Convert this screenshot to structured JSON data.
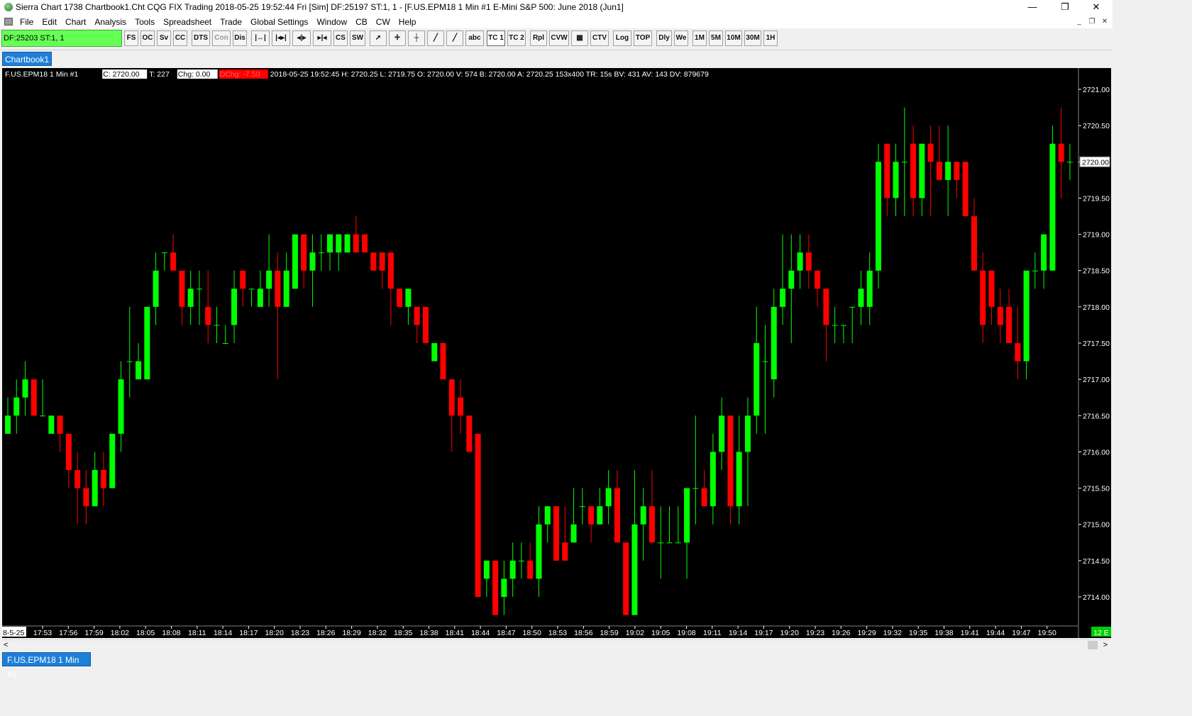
{
  "window": {
    "title": "Sierra Chart 1738 Chartbook1.Cht  CQG FIX Trading 2018-05-25  19:52:44 Fri [Sim]  DF:25197  ST:1, 1 - [F.US.EPM18  1 Min   #1  E-Mini S&P 500: June 2018 (Jun1]",
    "controls": {
      "minimize": "—",
      "restore": "❐",
      "close": "✕"
    }
  },
  "menu": {
    "items": [
      "File",
      "Edit",
      "Chart",
      "Analysis",
      "Tools",
      "Spreadsheet",
      "Trade",
      "Global Settings",
      "Window",
      "CB",
      "CW",
      "Help"
    ],
    "mdi_controls": {
      "minimize": "_",
      "restore": "❐",
      "close": "✕"
    }
  },
  "toolbar": {
    "df_label": "DF:25203  ST:1, 1",
    "buttons": [
      "FS",
      "OC",
      "Sv",
      "CC",
      "DTS",
      "Con",
      "Dis",
      "|↔|",
      "|◂▸|",
      "◂|▸",
      "▸|◂",
      "CS",
      "SW",
      "➚",
      "✛",
      "┼",
      "╱",
      "╱",
      "abc",
      "TC 1",
      "TC 2",
      "Rpl",
      "CVW",
      "▦",
      "CTV",
      "Log",
      "TOP",
      "Dly",
      "We",
      "1M",
      "5M",
      "10M",
      "30M",
      "1H"
    ]
  },
  "tabs": {
    "chartbook": "Chartbook1",
    "sheet": "F.US.EPM18  1 Min   #1"
  },
  "scrollbar": {
    "left_arrow": "<",
    "right_arrow": ">"
  },
  "chart_data": {
    "type": "candlestick",
    "symbol": "F.US.EPM18",
    "interval": "1 Min",
    "chart_number": "#1",
    "info_line": {
      "symbol_text": "F.US.EPM18  1 Min   #1",
      "close": "C: 2720.00",
      "trades": "T: 227",
      "chg": "Chg: 0.00",
      "dchg": "DChg: -7.50",
      "rest": "2018-05-25 19:52:45 H: 2720.25 L: 2719.75 O: 2720.00 V: 574 B: 2720.00 A: 2720.25 153x400 TR: 15s BV: 431 AV: 143 DV: 879679"
    },
    "colors": {
      "up": "#00ff00",
      "down": "#ff0000",
      "background": "#000000",
      "text": "#ffffff",
      "dchg_bg": "#ff0000",
      "last_price_bg": "#ffffff",
      "indicator_bg": "#00cc00"
    },
    "y_axis": {
      "min": 2713.5,
      "max": 2721.3,
      "ticks": [
        "2721.00",
        "2720.50",
        "2720.00",
        "2719.50",
        "2719.00",
        "2718.50",
        "2718.00",
        "2717.50",
        "2717.00",
        "2716.50",
        "2716.00",
        "2715.50",
        "2715.00",
        "2714.50",
        "2714.00"
      ],
      "last_price_label": "2720.00"
    },
    "x_axis": {
      "start_label": "8-5-25",
      "labels": [
        "17:53",
        "17:56",
        "17:59",
        "18:02",
        "18:05",
        "18:08",
        "18:11",
        "18:14",
        "18:17",
        "18:20",
        "18:23",
        "18:26",
        "18:29",
        "18:32",
        "18:35",
        "18:38",
        "18:41",
        "18:44",
        "18:47",
        "18:50",
        "18:53",
        "18:56",
        "18:59",
        "19:02",
        "19:05",
        "19:08",
        "19:11",
        "19:14",
        "19:17",
        "19:20",
        "19:23",
        "19:26",
        "19:29",
        "19:32",
        "19:35",
        "19:38",
        "19:41",
        "19:44",
        "19:47",
        "19:50"
      ],
      "indicator": "12 E"
    },
    "candles": [
      [
        2716.25,
        2716.75,
        2716.25,
        2716.5
      ],
      [
        2716.5,
        2717.0,
        2716.25,
        2716.75
      ],
      [
        2716.75,
        2717.25,
        2716.5,
        2717.0
      ],
      [
        2717.0,
        2717.0,
        2716.5,
        2716.5
      ],
      [
        2716.5,
        2717.0,
        2716.5,
        2716.5
      ],
      [
        2716.25,
        2716.5,
        2716.25,
        2716.5
      ],
      [
        2716.5,
        2716.5,
        2716.0,
        2716.25
      ],
      [
        2716.25,
        2716.25,
        2715.5,
        2715.75
      ],
      [
        2715.75,
        2716.0,
        2715.0,
        2715.5
      ],
      [
        2715.5,
        2715.75,
        2715.0,
        2715.25
      ],
      [
        2715.25,
        2716.0,
        2715.25,
        2715.75
      ],
      [
        2715.75,
        2716.0,
        2715.25,
        2715.5
      ],
      [
        2715.5,
        2716.25,
        2715.5,
        2716.25
      ],
      [
        2716.25,
        2717.25,
        2716.0,
        2717.0
      ],
      [
        2717.25,
        2718.0,
        2716.75,
        2717.25
      ],
      [
        2717.0,
        2717.5,
        2717.0,
        2717.25
      ],
      [
        2717.0,
        2718.0,
        2717.0,
        2718.0
      ],
      [
        2718.0,
        2718.75,
        2717.75,
        2718.5
      ],
      [
        2718.75,
        2718.75,
        2718.5,
        2718.75
      ],
      [
        2718.75,
        2719.0,
        2718.5,
        2718.5
      ],
      [
        2718.5,
        2718.5,
        2717.75,
        2718.0
      ],
      [
        2718.0,
        2718.5,
        2717.75,
        2718.25
      ],
      [
        2718.25,
        2718.5,
        2717.75,
        2718.25
      ],
      [
        2718.0,
        2718.5,
        2717.5,
        2717.75
      ],
      [
        2717.75,
        2718.0,
        2717.5,
        2717.75
      ],
      [
        2717.5,
        2717.75,
        2717.5,
        2717.5
      ],
      [
        2717.75,
        2718.5,
        2717.5,
        2718.25
      ],
      [
        2718.5,
        2718.5,
        2718.0,
        2718.25
      ],
      [
        2718.25,
        2718.25,
        2718.0,
        2718.25
      ],
      [
        2718.0,
        2718.5,
        2718.0,
        2718.25
      ],
      [
        2718.25,
        2719.0,
        2718.0,
        2718.5
      ],
      [
        2718.5,
        2718.75,
        2717.0,
        2718.0
      ],
      [
        2718.0,
        2718.75,
        2718.0,
        2718.5
      ],
      [
        2718.25,
        2719.0,
        2718.25,
        2719.0
      ],
      [
        2719.0,
        2719.0,
        2718.25,
        2718.5
      ],
      [
        2718.5,
        2719.0,
        2718.0,
        2718.75
      ],
      [
        2718.75,
        2719.0,
        2718.5,
        2718.75
      ],
      [
        2718.75,
        2719.0,
        2718.5,
        2719.0
      ],
      [
        2718.75,
        2719.0,
        2718.5,
        2719.0
      ],
      [
        2718.75,
        2719.0,
        2718.75,
        2719.0
      ],
      [
        2719.0,
        2719.25,
        2718.75,
        2718.75
      ],
      [
        2719.0,
        2719.0,
        2718.75,
        2718.75
      ],
      [
        2718.75,
        2718.75,
        2718.5,
        2718.5
      ],
      [
        2718.75,
        2718.75,
        2718.25,
        2718.5
      ],
      [
        2718.75,
        2718.75,
        2717.75,
        2718.25
      ],
      [
        2718.25,
        2718.25,
        2718.0,
        2718.0
      ],
      [
        2718.0,
        2718.25,
        2717.75,
        2718.25
      ],
      [
        2718.0,
        2718.0,
        2717.5,
        2717.75
      ],
      [
        2718.0,
        2718.0,
        2717.5,
        2717.5
      ],
      [
        2717.25,
        2717.5,
        2717.25,
        2717.5
      ],
      [
        2717.5,
        2717.5,
        2717.0,
        2717.0
      ],
      [
        2717.0,
        2717.0,
        2716.0,
        2716.5
      ],
      [
        2716.75,
        2717.0,
        2716.25,
        2716.5
      ],
      [
        2716.5,
        2716.5,
        2716.0,
        2716.0
      ],
      [
        2716.25,
        2716.25,
        2714.0,
        2714.0
      ],
      [
        2714.25,
        2714.5,
        2714.0,
        2714.5
      ],
      [
        2714.5,
        2714.5,
        2713.75,
        2713.75
      ],
      [
        2714.0,
        2714.5,
        2713.75,
        2714.25
      ],
      [
        2714.25,
        2714.75,
        2714.0,
        2714.5
      ],
      [
        2714.5,
        2714.75,
        2714.25,
        2714.5
      ],
      [
        2714.5,
        2714.75,
        2714.25,
        2714.25
      ],
      [
        2714.25,
        2715.25,
        2714.0,
        2715.0
      ],
      [
        2715.0,
        2715.25,
        2714.75,
        2715.25
      ],
      [
        2715.25,
        2715.25,
        2714.5,
        2714.5
      ],
      [
        2714.75,
        2715.25,
        2714.5,
        2714.5
      ],
      [
        2714.75,
        2715.5,
        2714.75,
        2715.0
      ],
      [
        2715.25,
        2715.5,
        2715.0,
        2715.25
      ],
      [
        2715.25,
        2715.25,
        2714.75,
        2715.0
      ],
      [
        2715.0,
        2715.5,
        2715.0,
        2715.25
      ],
      [
        2715.25,
        2715.75,
        2715.0,
        2715.5
      ],
      [
        2715.5,
        2715.75,
        2714.75,
        2714.75
      ],
      [
        2714.75,
        2714.75,
        2713.75,
        2713.75
      ],
      [
        2713.75,
        2715.75,
        2713.75,
        2715.0
      ],
      [
        2715.0,
        2715.5,
        2714.5,
        2715.25
      ],
      [
        2715.25,
        2715.75,
        2714.75,
        2714.75
      ],
      [
        2714.75,
        2715.25,
        2714.25,
        2714.75
      ],
      [
        2714.75,
        2715.25,
        2714.75,
        2714.75
      ],
      [
        2714.75,
        2715.25,
        2714.75,
        2714.75
      ],
      [
        2714.75,
        2715.5,
        2714.25,
        2715.5
      ],
      [
        2715.5,
        2716.5,
        2715.0,
        2715.5
      ],
      [
        2715.5,
        2715.75,
        2715.25,
        2715.25
      ],
      [
        2715.25,
        2716.25,
        2715.0,
        2716.0
      ],
      [
        2716.0,
        2716.75,
        2715.75,
        2716.5
      ],
      [
        2716.5,
        2716.5,
        2715.0,
        2715.25
      ],
      [
        2715.25,
        2716.5,
        2715.0,
        2716.0
      ],
      [
        2716.0,
        2716.75,
        2715.25,
        2716.5
      ],
      [
        2716.5,
        2718.0,
        2716.25,
        2717.5
      ],
      [
        2717.25,
        2717.75,
        2716.25,
        2717.25
      ],
      [
        2717.0,
        2718.25,
        2716.75,
        2718.0
      ],
      [
        2718.0,
        2719.0,
        2717.75,
        2718.25
      ],
      [
        2718.25,
        2719.0,
        2717.5,
        2718.5
      ],
      [
        2718.5,
        2719.0,
        2718.25,
        2718.75
      ],
      [
        2718.75,
        2719.0,
        2718.25,
        2718.5
      ],
      [
        2718.5,
        2718.5,
        2718.0,
        2718.25
      ],
      [
        2718.25,
        2718.25,
        2717.25,
        2717.75
      ],
      [
        2717.75,
        2718.0,
        2717.5,
        2717.75
      ],
      [
        2717.75,
        2717.75,
        2717.5,
        2717.75
      ],
      [
        2718.0,
        2718.0,
        2717.5,
        2718.0
      ],
      [
        2718.0,
        2718.5,
        2717.75,
        2718.25
      ],
      [
        2718.0,
        2718.75,
        2717.75,
        2718.5
      ],
      [
        2718.5,
        2720.25,
        2718.25,
        2720.0
      ],
      [
        2720.25,
        2720.25,
        2719.25,
        2719.5
      ],
      [
        2719.5,
        2720.25,
        2719.25,
        2720.0
      ],
      [
        2720.0,
        2720.75,
        2719.25,
        2720.0
      ],
      [
        2720.25,
        2720.5,
        2719.25,
        2719.5
      ],
      [
        2719.5,
        2720.25,
        2719.25,
        2720.25
      ],
      [
        2720.25,
        2720.5,
        2719.25,
        2720.0
      ],
      [
        2720.0,
        2720.5,
        2719.75,
        2719.75
      ],
      [
        2719.75,
        2720.5,
        2719.25,
        2720.0
      ],
      [
        2720.0,
        2720.0,
        2719.5,
        2719.75
      ],
      [
        2720.0,
        2720.0,
        2719.25,
        2719.25
      ],
      [
        2719.25,
        2719.5,
        2718.5,
        2718.5
      ],
      [
        2718.5,
        2718.75,
        2717.5,
        2717.75
      ],
      [
        2718.5,
        2718.5,
        2717.75,
        2718.0
      ],
      [
        2718.0,
        2718.25,
        2717.5,
        2717.75
      ],
      [
        2718.0,
        2718.25,
        2717.5,
        2717.5
      ],
      [
        2717.5,
        2718.0,
        2717.0,
        2717.25
      ],
      [
        2717.25,
        2718.5,
        2717.0,
        2718.5
      ],
      [
        2718.5,
        2718.75,
        2718.25,
        2718.5
      ],
      [
        2718.5,
        2719.0,
        2718.25,
        2719.0
      ],
      [
        2718.5,
        2720.5,
        2718.5,
        2720.25
      ],
      [
        2720.25,
        2720.75,
        2719.5,
        2720.0
      ],
      [
        2720.0,
        2720.25,
        2719.75,
        2720.0
      ]
    ]
  }
}
